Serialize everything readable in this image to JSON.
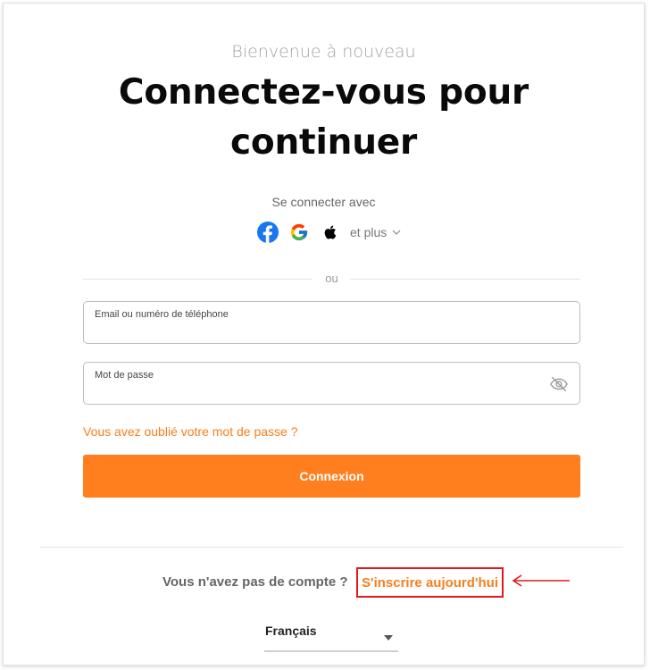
{
  "header": {
    "welcome": "Bienvenue à nouveau",
    "title_line1": "Connectez-vous pour",
    "title_line2": "continuer"
  },
  "social": {
    "label": "Se connecter avec",
    "providers": [
      {
        "name": "facebook-icon",
        "color": "#1877f2"
      },
      {
        "name": "google-icon",
        "color": "#4285f4"
      },
      {
        "name": "apple-icon",
        "color": "#000000"
      }
    ],
    "more_label": "et plus"
  },
  "divider_text": "ou",
  "form": {
    "email_label": "Email ou numéro de téléphone",
    "email_value": "",
    "password_label": "Mot de passe",
    "password_value": "",
    "forgot_label": "Vous avez oublié votre mot de passe ?",
    "submit_label": "Connexion"
  },
  "footer": {
    "no_account": "Vous n'avez pas de compte ?",
    "signup_label": "S'inscrire aujourd'hui",
    "language": "Français"
  },
  "colors": {
    "accent": "#ff7e1e",
    "link": "#f47f1f",
    "highlight": "#e0191c"
  }
}
